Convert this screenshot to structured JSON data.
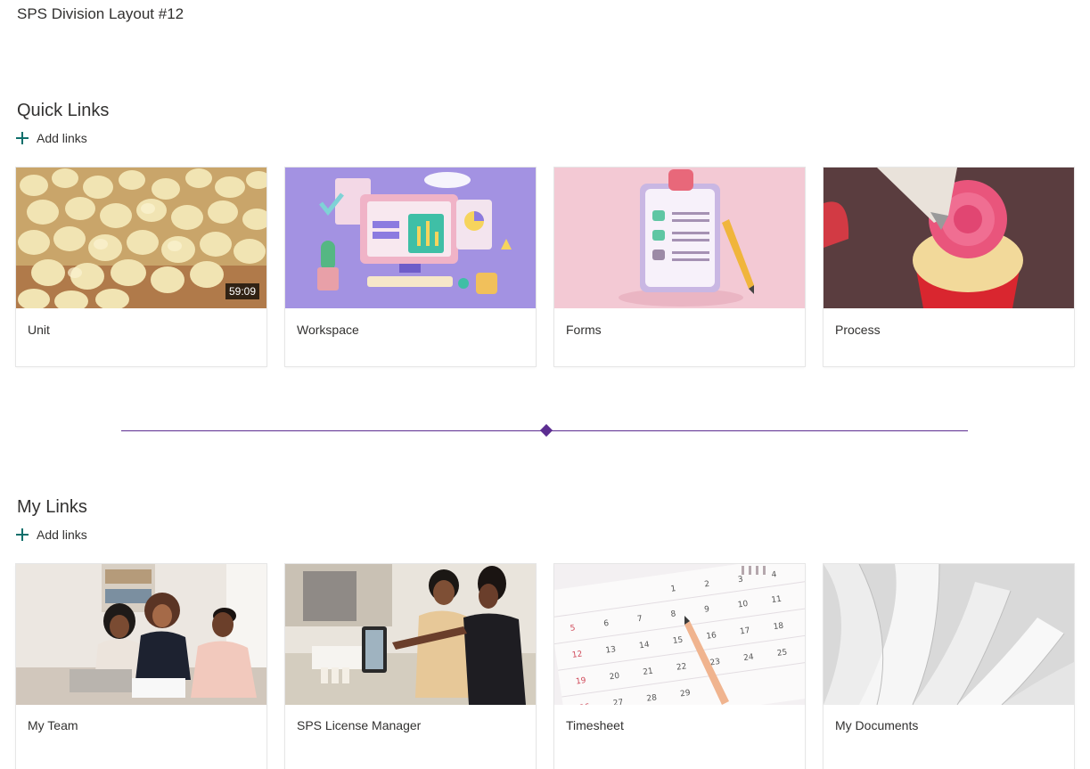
{
  "page": {
    "title": "SPS Division Layout #12"
  },
  "quick_links": {
    "title": "Quick Links",
    "add_label": "Add links",
    "cards": [
      {
        "label": "Unit",
        "duration": "59:09"
      },
      {
        "label": "Workspace"
      },
      {
        "label": "Forms"
      },
      {
        "label": "Process"
      }
    ]
  },
  "my_links": {
    "title": "My Links",
    "add_label": "Add links",
    "cards": [
      {
        "label": "My Team"
      },
      {
        "label": "SPS License Manager"
      },
      {
        "label": "Timesheet"
      },
      {
        "label": "My Documents"
      }
    ]
  },
  "colors": {
    "accent": "#5c2d91",
    "add_icon": "#0f6f6b"
  }
}
